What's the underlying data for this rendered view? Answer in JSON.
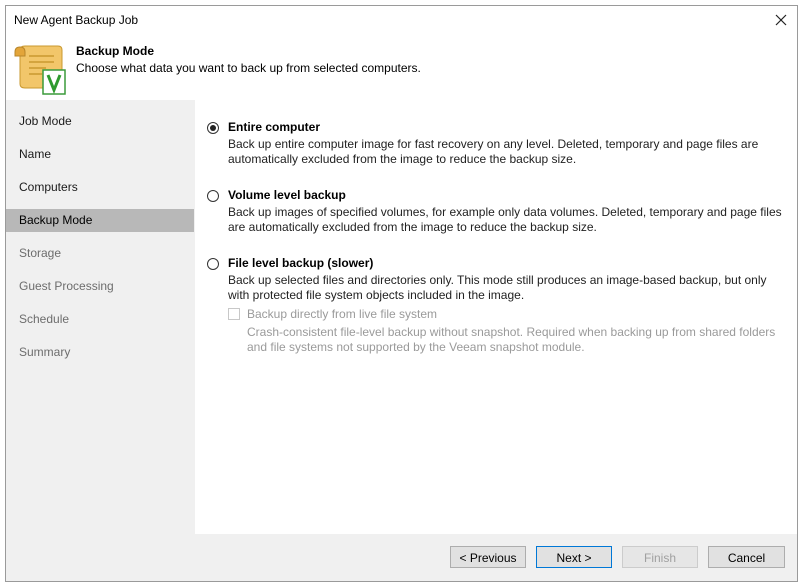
{
  "window": {
    "title": "New Agent Backup Job"
  },
  "header": {
    "icon": "veeam-backup-scroll-icon",
    "title": "Backup Mode",
    "description": "Choose what data you want to back up from selected computers."
  },
  "sidebar": {
    "items": [
      {
        "label": "Job Mode",
        "state": "done"
      },
      {
        "label": "Name",
        "state": "done"
      },
      {
        "label": "Computers",
        "state": "done"
      },
      {
        "label": "Backup Mode",
        "state": "active"
      },
      {
        "label": "Storage",
        "state": "future"
      },
      {
        "label": "Guest Processing",
        "state": "future"
      },
      {
        "label": "Schedule",
        "state": "future"
      },
      {
        "label": "Summary",
        "state": "future"
      }
    ]
  },
  "options": {
    "entire": {
      "label": "Entire computer",
      "checked": true,
      "desc1": "Back up entire computer image for fast recovery on any level. Deleted, temporary and page files are",
      "desc2": "automatically excluded from the image to reduce the backup size."
    },
    "volume": {
      "label": "Volume level backup",
      "checked": false,
      "desc1": "Back up images of specified volumes, for example only data volumes. Deleted, temporary and page files",
      "desc2": "are automatically excluded from the image to reduce the backup size."
    },
    "file": {
      "label": "File level backup (slower)",
      "checked": false,
      "desc1": "Back up selected files and directories only. This mode still produces an image-based backup, but only",
      "desc2": "with protected file system objects included in the image."
    },
    "live": {
      "label": "Backup directly from live file system",
      "checked": false,
      "enabled": false,
      "desc1": "Crash-consistent file-level backup without snapshot. Required when backing up from shared folders",
      "desc2": "and file systems not supported by the Veeam snapshot module."
    }
  },
  "footer": {
    "previous": "< Previous",
    "next": "Next >",
    "finish": "Finish",
    "cancel": "Cancel"
  },
  "colors": {
    "accent": "#0078d7",
    "active_nav": "#b8b8b8",
    "panel": "#f0f0f0",
    "disabled_text": "#9a9a9a"
  }
}
